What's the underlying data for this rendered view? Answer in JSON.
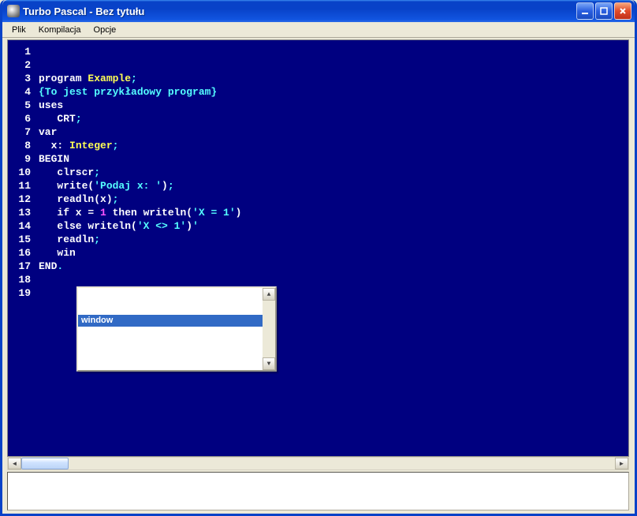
{
  "window": {
    "title": "Turbo Pascal - Bez tytułu"
  },
  "menu": {
    "items": [
      "Plik",
      "Kompilacja",
      "Opcje"
    ]
  },
  "autocomplete": {
    "selected": "window"
  },
  "code": {
    "lines": [
      {
        "n": 1,
        "t": [
          [
            "kw",
            "program "
          ],
          [
            "id",
            "Example"
          ],
          [
            "sym",
            ";"
          ]
        ]
      },
      {
        "n": 2,
        "t": []
      },
      {
        "n": 3,
        "t": [
          [
            "com",
            "{To jest przykładowy program}"
          ]
        ]
      },
      {
        "n": 4,
        "t": []
      },
      {
        "n": 5,
        "t": [
          [
            "kw",
            "uses"
          ]
        ]
      },
      {
        "n": 6,
        "t": [
          [
            "kw",
            "   CRT"
          ],
          [
            "sym",
            ";"
          ]
        ]
      },
      {
        "n": 7,
        "t": []
      },
      {
        "n": 8,
        "t": [
          [
            "kw",
            "var"
          ]
        ]
      },
      {
        "n": 9,
        "t": [
          [
            "kw",
            "  x: "
          ],
          [
            "id",
            "Integer"
          ],
          [
            "sym",
            ";"
          ]
        ]
      },
      {
        "n": 10,
        "t": []
      },
      {
        "n": 11,
        "t": [
          [
            "kw",
            "BEGIN"
          ]
        ]
      },
      {
        "n": 12,
        "t": [
          [
            "kw",
            "   clrscr"
          ],
          [
            "sym",
            ";"
          ]
        ]
      },
      {
        "n": 13,
        "t": [
          [
            "kw",
            "   write("
          ],
          [
            "str",
            "'Podaj x: '"
          ],
          [
            "kw",
            ")"
          ],
          [
            "sym",
            ";"
          ]
        ]
      },
      {
        "n": 14,
        "t": [
          [
            "kw",
            "   readln(x)"
          ],
          [
            "sym",
            ";"
          ]
        ]
      },
      {
        "n": 15,
        "t": [
          [
            "kw",
            "   if x = "
          ],
          [
            "num",
            "1"
          ],
          [
            "kw",
            " then writeln("
          ],
          [
            "str",
            "'X = 1'"
          ],
          [
            "kw",
            ")"
          ]
        ]
      },
      {
        "n": 16,
        "t": [
          [
            "kw",
            "   else writeln("
          ],
          [
            "str",
            "'X <> 1'"
          ],
          [
            "kw",
            ")"
          ],
          [
            "str",
            "'"
          ]
        ]
      },
      {
        "n": 17,
        "t": [
          [
            "kw",
            "   readln"
          ],
          [
            "sym",
            ";"
          ]
        ]
      },
      {
        "n": 18,
        "t": [
          [
            "kw",
            "   win"
          ]
        ]
      },
      {
        "n": 19,
        "t": [
          [
            "kw",
            "END"
          ],
          [
            "sym",
            "."
          ]
        ]
      }
    ]
  }
}
